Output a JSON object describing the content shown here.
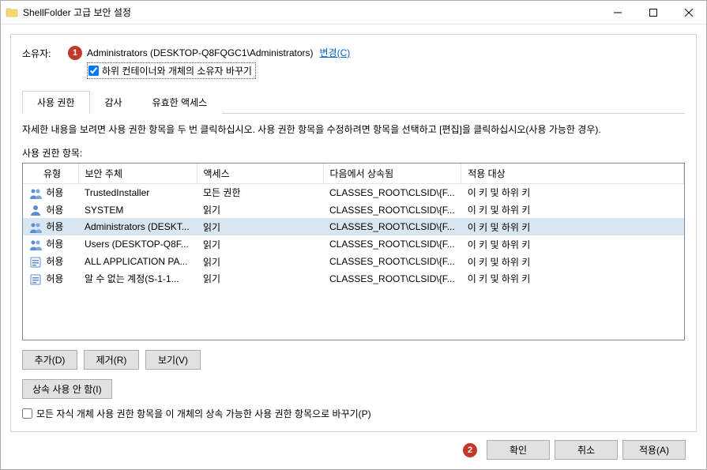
{
  "title": "ShellFolder 고급 보안 설정",
  "owner": {
    "label": "소유자:",
    "value": "Administrators (DESKTOP-Q8FQGC1\\Administrators)",
    "change_link": "변경(C)",
    "replace_checkbox_label": "하위 컨테이너와 개체의 소유자 바꾸기"
  },
  "tabs": [
    {
      "label": "사용 권한",
      "active": true
    },
    {
      "label": "감사",
      "active": false
    },
    {
      "label": "유효한 액세스",
      "active": false
    }
  ],
  "help_text": "자세한 내용을 보려면 사용 권한 항목을 두 번 클릭하십시오. 사용 권한 항목을 수정하려면 항목을 선택하고 [편집]을 클릭하십시오(사용 가능한 경우).",
  "list_label": "사용 권한 항목:",
  "columns": {
    "type": "유형",
    "principal": "보안 주체",
    "access": "액세스",
    "inherited_from": "다음에서 상속됨",
    "applies_to": "적용 대상"
  },
  "rows": [
    {
      "icon": "users",
      "type": "허용",
      "principal": "TrustedInstaller",
      "access": "모든 권한",
      "inherited": "CLASSES_ROOT\\CLSID\\{F...",
      "applies": "이 키 및 하위 키",
      "selected": false
    },
    {
      "icon": "user",
      "type": "허용",
      "principal": "SYSTEM",
      "access": "읽기",
      "inherited": "CLASSES_ROOT\\CLSID\\{F...",
      "applies": "이 키 및 하위 키",
      "selected": false
    },
    {
      "icon": "users",
      "type": "허용",
      "principal": "Administrators (DESKT...",
      "access": "읽기",
      "inherited": "CLASSES_ROOT\\CLSID\\{F...",
      "applies": "이 키 및 하위 키",
      "selected": true
    },
    {
      "icon": "users",
      "type": "허용",
      "principal": "Users (DESKTOP-Q8F...",
      "access": "읽기",
      "inherited": "CLASSES_ROOT\\CLSID\\{F...",
      "applies": "이 키 및 하위 키",
      "selected": false
    },
    {
      "icon": "app",
      "type": "허용",
      "principal": "ALL APPLICATION PA...",
      "access": "읽기",
      "inherited": "CLASSES_ROOT\\CLSID\\{F...",
      "applies": "이 키 및 하위 키",
      "selected": false
    },
    {
      "icon": "app",
      "type": "허용",
      "principal": "알 수 없는 계정(S-1-1...",
      "access": "읽기",
      "inherited": "CLASSES_ROOT\\CLSID\\{F...",
      "applies": "이 키 및 하위 키",
      "selected": false
    }
  ],
  "buttons": {
    "add": "추가(D)",
    "remove": "제거(R)",
    "view": "보기(V)",
    "disable_inherit": "상속 사용 안 함(I)",
    "replace_all_label": "모든 자식 개체 사용 권한 항목을 이 개체의 상속 가능한 사용 권한 항목으로 바꾸기(P)",
    "ok": "확인",
    "cancel": "취소",
    "apply": "적용(A)"
  },
  "markers": {
    "one": "1",
    "two": "2"
  }
}
